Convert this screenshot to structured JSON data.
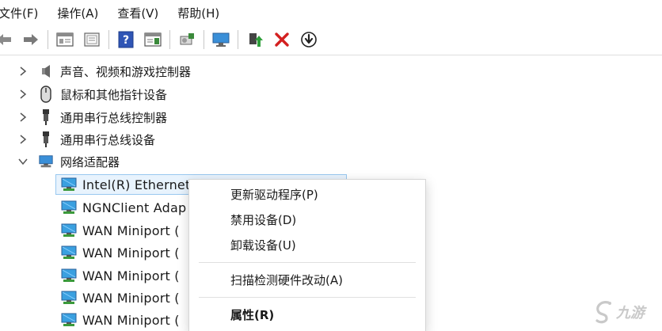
{
  "menubar": {
    "file": "文件(F)",
    "action": "操作(A)",
    "view": "查看(V)",
    "help": "帮助(H)"
  },
  "toolbar": {
    "icons": [
      "back-icon",
      "forward-icon",
      "properties-panel-icon",
      "console-tree-icon",
      "help-icon",
      "action-pane-icon",
      "scan-hardware-icon",
      "monitor-icon",
      "update-driver-icon",
      "uninstall-icon",
      "disable-device-icon"
    ],
    "uninstall_color": "#d32020"
  },
  "tree": {
    "categories": [
      {
        "label": "声音、视频和游戏控制器",
        "expanded": false,
        "icon": "speaker-icon"
      },
      {
        "label": "鼠标和其他指针设备",
        "expanded": false,
        "icon": "mouse-icon"
      },
      {
        "label": "通用串行总线控制器",
        "expanded": false,
        "icon": "usb-icon"
      },
      {
        "label": "通用串行总线设备",
        "expanded": false,
        "icon": "usb-icon"
      },
      {
        "label": "网络适配器",
        "expanded": true,
        "icon": "network-icon"
      }
    ],
    "network_children": [
      "Intel(R) Ethernet",
      "NGNClient Adap",
      "WAN Miniport (",
      "WAN Miniport (",
      "WAN Miniport (",
      "WAN Miniport (",
      "WAN Miniport ("
    ]
  },
  "context_menu": {
    "update_driver": "更新驱动程序(P)",
    "disable_device": "禁用设备(D)",
    "uninstall_device": "卸载设备(U)",
    "scan_hardware": "扫描检测硬件改动(A)",
    "properties": "属性(R)"
  },
  "watermark": {
    "text": "九游"
  },
  "colors": {
    "accent_blue": "#2a6fd1",
    "selection_fill": "#e8f3fd",
    "selection_border": "#99c8f0"
  }
}
